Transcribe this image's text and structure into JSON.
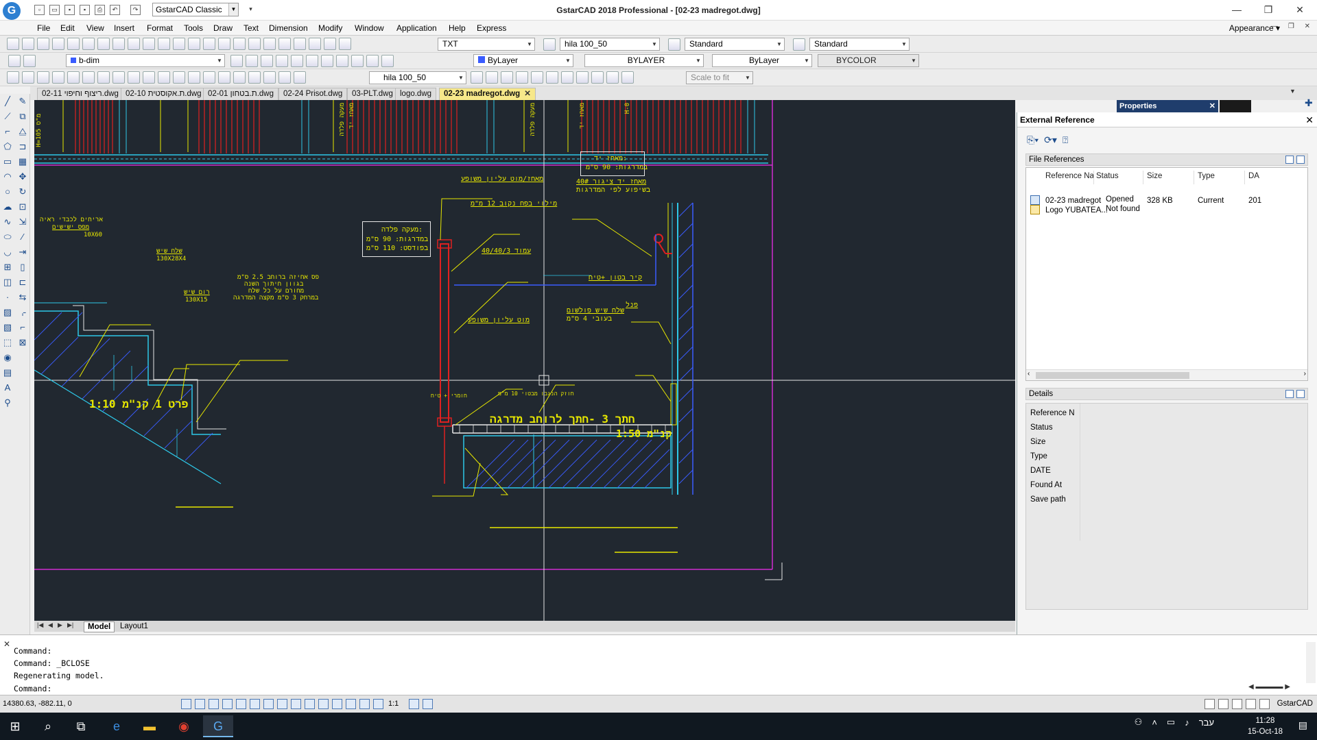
{
  "window": {
    "title": "GstarCAD 2018 Professional - [02-23 madregot.dwg]",
    "workspace": "GstarCAD Classic",
    "app_icon": "gstarcad-logo-icon"
  },
  "menu": {
    "items": [
      "File",
      "Edit",
      "View",
      "Insert",
      "Format",
      "Tools",
      "Draw",
      "Text",
      "Dimension",
      "Modify",
      "Window",
      "Application",
      "Help",
      "Express"
    ],
    "appearance": "Appearance"
  },
  "toolbars": {
    "text_style": "TXT",
    "dim_style": "hila 100_50",
    "table_style": "Standard",
    "multileader_style": "Standard",
    "layer": "b-dim",
    "color": "ByLayer",
    "linetype": "BYLAYER",
    "lineweight": "ByLayer",
    "plotstyle": "BYCOLOR",
    "dim_style_2": "hila 100_50",
    "viewport_scale": "Scale to fit"
  },
  "file_tabs": [
    {
      "label": "02-11 ריצוף וחיפוי.dwg",
      "active": false
    },
    {
      "label": "02-10 ת.אקוסטית.dwg",
      "active": false
    },
    {
      "label": "02-01 ת.בטחון.dwg",
      "active": false
    },
    {
      "label": "02-24 Prisot.dwg",
      "active": false
    },
    {
      "label": "03-PLT.dwg",
      "active": false
    },
    {
      "label": "logo.dwg",
      "active": false
    },
    {
      "label": "02-23 madregot.dwg",
      "active": true
    }
  ],
  "drawing": {
    "texts": {
      "t1": "מאחז יד:",
      "t2": "במדרגות: 90 ס\"מ",
      "t3": "מאחז יד ציגור 40#",
      "t4": "בשיפוע לפי המדרגות",
      "t5": "מאחז/מוט עליון משופע",
      "t6": "מילוי בפח נקוב 12 מ\"מ",
      "t7": "מעקה פלדה:",
      "t8": "במדרגות: 90 ס\"מ",
      "t9": "בפודסט: 110 ס\"מ",
      "t10": "עמוד 40/40/3",
      "t11": "קיר בטון +טיח",
      "t12": "פנל",
      "t13": "שלח שיש פולשום",
      "t14": "בעובי 4 ס\"מ",
      "t15": "מוט עליון משופע",
      "t16": "אריחים לכבדי ראיה",
      "t17": "מפס ישישים",
      "t18": "10X60",
      "t19": "שלח שיש",
      "t20": "130X28X4",
      "t21": "רום שיש",
      "t22": "130X15",
      "t23": "פס אחיזה ברוחב 2.5 ס\"מ",
      "t24": "בגוון חיתוך השנה",
      "t25": "מחורם על כל שלח",
      "t26": "במרחק 3 ס\"מ מקצה המדרגה",
      "t27": "חתך 3 -חתך לרוחב מדרגה",
      "t28": "קנ\"מ 1:50",
      "t29": "פרט 1   קנ\"מ 1:10",
      "t30": "חומרי + טיח",
      "t31": "חוזק הנגבו מבטוי 10 מ\"מ",
      "t32": "H=105 מ\"ס",
      "t33": "מעקה פלדה",
      "t34": "מאחז יד",
      "t35": "מעקה פלדה",
      "t36": "מאחז יד",
      "t37": "H-0"
    }
  },
  "model_tabs": {
    "model": "Model",
    "layout": "Layout1"
  },
  "xref_panel": {
    "title": "External Reference",
    "file_refs_header": "File References",
    "columns": [
      "Reference Na",
      "Status",
      "Size",
      "Type",
      "DA"
    ],
    "rows": [
      {
        "name": "02-23 madregot",
        "status": "Opened",
        "size": "328 KB",
        "type": "Current",
        "date": "201"
      },
      {
        "name": "Logo YUBATEA...",
        "status": "Not found",
        "size": "",
        "type": "",
        "date": ""
      }
    ],
    "details_header": "Details",
    "details_labels": [
      "Reference N",
      "Status",
      "Size",
      "Type",
      "DATE",
      "Found At",
      "Save path"
    ]
  },
  "properties_tab": "Properties",
  "command": {
    "lines": [
      "Command:",
      "Command: _BCLOSE",
      "Regenerating model."
    ],
    "prompt": "Command:"
  },
  "status": {
    "coords": "14380.63, -882.11, 0",
    "scale": "1:1",
    "brand": "GstarCAD"
  },
  "taskbar": {
    "lang": "עבר",
    "time": "11:28",
    "date": "15-Oct-18"
  },
  "colors": {
    "canvas_bg": "#212830",
    "cad_yellow": "#e8e800",
    "cad_red": "#e02020",
    "cad_cyan": "#2ec8e8",
    "cad_blue": "#3a5cff",
    "cad_magenta": "#d02cd0"
  }
}
